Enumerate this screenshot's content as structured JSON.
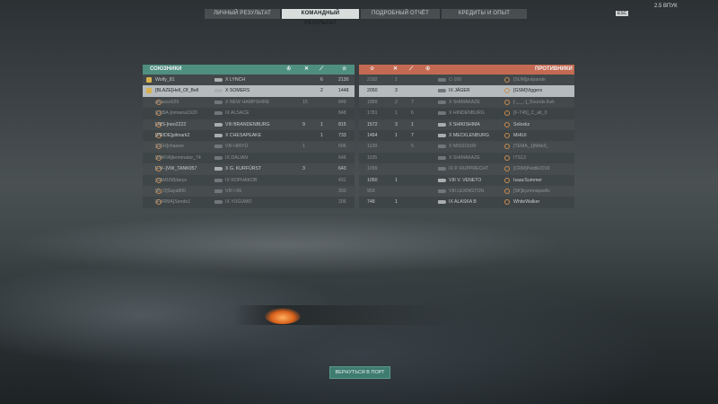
{
  "tabs": [
    {
      "label": "ЛИЧНЫЙ РЕЗУЛЬТАТ"
    },
    {
      "label": "КОМАНДНЫЙ РЕЗУЛЬТАТ"
    },
    {
      "label": "ПОДРОБНЫЙ ОТЧЁТ"
    },
    {
      "label": "КРЕДИТЫ И ОПЫТ"
    }
  ],
  "esc_label": "ESC",
  "credits_text": "2.5 ВПУК",
  "allies": {
    "title": "СОЮЗНИКИ",
    "players": [
      {
        "name": "Wolfy_81",
        "ship": "X LYNCH",
        "c1": "",
        "c2": "6",
        "score": "2130",
        "hl": false,
        "dead": false
      },
      {
        "name": "[BLAZE]Hell_Of_Bell",
        "ship": "X SOMERS",
        "c1": "",
        "c2": "2",
        "score": "1448",
        "hl": true,
        "dead": false
      },
      {
        "name": "picasso029",
        "ship": "X NEW HAMPSHIRE",
        "c1": "15",
        "c2": "",
        "score": "849",
        "hl": false,
        "dead": true
      },
      {
        "name": "[LKBA-]omsera1920",
        "ship": "IX ALSACE",
        "c1": "",
        "c2": "",
        "score": "848",
        "hl": false,
        "dead": true
      },
      {
        "name": "[-MS-]neo2222",
        "ship": "VIII BRANDENBURG",
        "c1": "9",
        "c2": "1",
        "score": "815",
        "hl": false,
        "dead": false
      },
      {
        "name": "[PRIDE]pilmark2",
        "ship": "X CHESAPEAKE",
        "c1": "",
        "c2": "1",
        "score": "733",
        "hl": false,
        "dead": false
      },
      {
        "name": "[GEH]chasew",
        "ship": "VIII HIRYŪ",
        "c1": "1",
        "c2": "",
        "score": "696",
        "hl": false,
        "dead": true
      },
      {
        "name": "[MAFIA]terminator_74",
        "ship": "IX DALIAN",
        "c1": "",
        "c2": "",
        "score": "646",
        "hl": false,
        "dead": true
      },
      {
        "name": "[--V--]VW_TANK057",
        "ship": "X G. KURFÜRST",
        "c1": "3",
        "c2": "",
        "score": "643",
        "hl": false,
        "dead": false
      },
      {
        "name": "[SAMUM]daryo",
        "ship": "IX KOPHAKOB",
        "c1": "",
        "c2": "",
        "score": "431",
        "hl": false,
        "dead": true
      },
      {
        "name": "[R_O]Saya800",
        "ship": "VIII I-56",
        "c1": "",
        "c2": "",
        "score": "303",
        "hl": false,
        "dead": true
      },
      {
        "name": "[FURMA]Sendo1",
        "ship": "IX YŪGUMO",
        "c1": "",
        "c2": "",
        "score": "206",
        "hl": false,
        "dead": true
      }
    ]
  },
  "enemies": {
    "title": "ПРОТИВНИКИ",
    "players": [
      {
        "name": "[SUM]pvtpande",
        "ship": "C-100",
        "c1": "1",
        "c2": "",
        "score": "2182",
        "dead": true,
        "hl": false
      },
      {
        "name": "[GSM]Viggers",
        "ship": "IX JÄGER",
        "c1": "3",
        "c2": "",
        "score": "2050",
        "dead": true,
        "hl": true
      },
      {
        "name": "[-___-]_Sounds.Kek",
        "ship": "X SHIMAKAZE",
        "c1": "2",
        "c2": "7",
        "score": "1889",
        "dead": true,
        "hl": false
      },
      {
        "name": "[F-T45]_C_alt_0",
        "ship": "X HINDENBURG",
        "c1": "1",
        "c2": "6",
        "score": "1781",
        "dead": true,
        "hl": false
      },
      {
        "name": "Soloxkz",
        "ship": "X SHIKISHIMA",
        "c1": "3",
        "c2": "1",
        "score": "1572",
        "dead": false,
        "hl": false
      },
      {
        "name": "MHIUI",
        "ship": "X MECKLENBURG",
        "c1": "1",
        "c2": "7",
        "score": "1464",
        "dead": false,
        "hl": false
      },
      {
        "name": "[TEMA_1]Mikk0_",
        "ship": "X MISSOURI",
        "c1": "",
        "c2": "5",
        "score": "1129",
        "dead": true,
        "hl": false
      },
      {
        "name": "ITS13",
        "ship": "X SHIMAKAZE",
        "c1": "",
        "c2": "",
        "score": "1105",
        "dead": true,
        "hl": false
      },
      {
        "name": "[CRM]Peidik2019",
        "ship": "IX P. RUPPRECHT",
        "c1": "",
        "c2": "",
        "score": "1099",
        "dead": true,
        "hl": false
      },
      {
        "name": "IsaacSummer",
        "ship": "VIII V. VENETO",
        "c1": "1",
        "c2": "",
        "score": "1050",
        "dead": false,
        "hl": false
      },
      {
        "name": "[SK]kyzmnapsellc",
        "ship": "VIII LEXINGTON",
        "c1": "",
        "c2": "",
        "score": "959",
        "dead": true,
        "hl": false
      },
      {
        "name": "WhiteWalker",
        "ship": "IX ALASKA B",
        "c1": "1",
        "c2": "",
        "score": "748",
        "dead": false,
        "hl": false
      }
    ]
  },
  "return_button": "ВЕРНУТЬСЯ В ПОРТ"
}
